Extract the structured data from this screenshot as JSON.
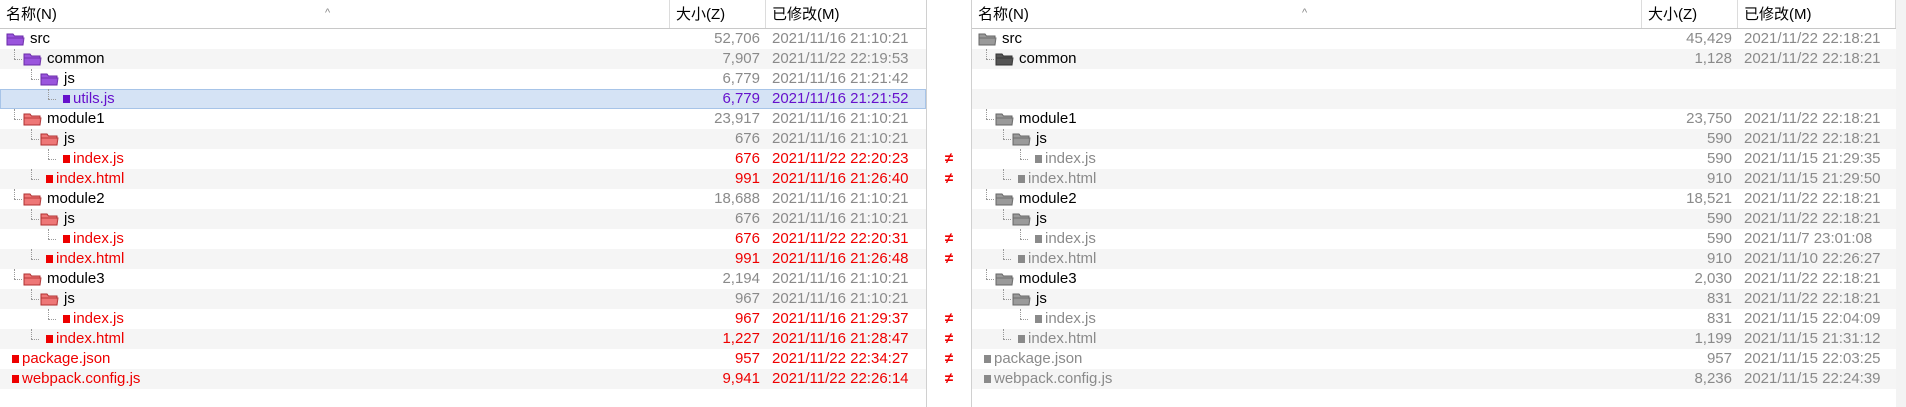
{
  "columns": {
    "name": "名称(N)",
    "size": "大小(Z)",
    "modified": "已修改(M)"
  },
  "diff_marker": "≠",
  "colors": {
    "modified": "#ee0000",
    "selected_text": "#6611cc",
    "unchanged": "#8a8a8a",
    "selection_bg": "#d5e3f5",
    "left_folder_modified": "#ee7777",
    "left_folder_selected": "#9a55dd",
    "right_folder": "#9a9a9a"
  },
  "left_pane": {
    "rows": [
      {
        "name": "src",
        "size": "52,706",
        "date": "2021/11/16 21:10:21",
        "type": "folder",
        "style": "gray",
        "depth": 0,
        "icon": "folder-purple-icon",
        "label_color": "black"
      },
      {
        "name": "common",
        "size": "7,907",
        "date": "2021/11/22 22:19:53",
        "type": "folder",
        "style": "gray",
        "depth": 1,
        "icon": "folder-purple-icon",
        "label_color": "black"
      },
      {
        "name": "js",
        "size": "6,779",
        "date": "2021/11/16 21:21:42",
        "type": "folder",
        "style": "gray",
        "depth": 2,
        "icon": "folder-purple-icon",
        "label_color": "black"
      },
      {
        "name": "utils.js",
        "size": "6,779",
        "date": "2021/11/16 21:21:52",
        "type": "file",
        "style": "purple",
        "depth": 3,
        "icon": "file-square-icon",
        "selected": true
      },
      {
        "name": "module1",
        "size": "23,917",
        "date": "2021/11/16 21:10:21",
        "type": "folder",
        "style": "gray",
        "depth": 1,
        "icon": "folder-red-icon",
        "label_color": "black"
      },
      {
        "name": "js",
        "size": "676",
        "date": "2021/11/16 21:10:21",
        "type": "folder",
        "style": "gray",
        "depth": 2,
        "icon": "folder-red-icon",
        "label_color": "black"
      },
      {
        "name": "index.js",
        "size": "676",
        "date": "2021/11/22 22:20:23",
        "type": "file",
        "style": "red",
        "depth": 3,
        "icon": "file-square-icon",
        "diff": true
      },
      {
        "name": "index.html",
        "size": "991",
        "date": "2021/11/16 21:26:40",
        "type": "file",
        "style": "red",
        "depth": 2,
        "icon": "file-square-icon",
        "diff": true
      },
      {
        "name": "module2",
        "size": "18,688",
        "date": "2021/11/16 21:10:21",
        "type": "folder",
        "style": "gray",
        "depth": 1,
        "icon": "folder-red-icon",
        "label_color": "black"
      },
      {
        "name": "js",
        "size": "676",
        "date": "2021/11/16 21:10:21",
        "type": "folder",
        "style": "gray",
        "depth": 2,
        "icon": "folder-red-icon",
        "label_color": "black"
      },
      {
        "name": "index.js",
        "size": "676",
        "date": "2021/11/22 22:20:31",
        "type": "file",
        "style": "red",
        "depth": 3,
        "icon": "file-square-icon",
        "diff": true
      },
      {
        "name": "index.html",
        "size": "991",
        "date": "2021/11/16 21:26:48",
        "type": "file",
        "style": "red",
        "depth": 2,
        "icon": "file-square-icon",
        "diff": true
      },
      {
        "name": "module3",
        "size": "2,194",
        "date": "2021/11/16 21:10:21",
        "type": "folder",
        "style": "gray",
        "depth": 1,
        "icon": "folder-red-icon",
        "label_color": "black"
      },
      {
        "name": "js",
        "size": "967",
        "date": "2021/11/16 21:10:21",
        "type": "folder",
        "style": "gray",
        "depth": 2,
        "icon": "folder-red-icon",
        "label_color": "black"
      },
      {
        "name": "index.js",
        "size": "967",
        "date": "2021/11/16 21:29:37",
        "type": "file",
        "style": "red",
        "depth": 3,
        "icon": "file-square-icon",
        "diff": true
      },
      {
        "name": "index.html",
        "size": "1,227",
        "date": "2021/11/16 21:28:47",
        "type": "file",
        "style": "red",
        "depth": 2,
        "icon": "file-square-icon",
        "diff": true
      },
      {
        "name": "package.json",
        "size": "957",
        "date": "2021/11/22 22:34:27",
        "type": "file",
        "style": "red",
        "depth": 0,
        "icon": "file-square-icon",
        "diff": true
      },
      {
        "name": "webpack.config.js",
        "size": "9,941",
        "date": "2021/11/22 22:26:14",
        "type": "file",
        "style": "red",
        "depth": 0,
        "icon": "file-square-icon",
        "diff": true
      }
    ]
  },
  "right_pane": {
    "rows": [
      {
        "name": "src",
        "size": "45,429",
        "date": "2021/11/22 22:18:21",
        "type": "folder",
        "style": "gray",
        "depth": 0,
        "icon": "folder-gray-icon",
        "label_color": "black"
      },
      {
        "name": "common",
        "size": "1,128",
        "date": "2021/11/22 22:18:21",
        "type": "folder",
        "style": "gray",
        "depth": 1,
        "icon": "folder-dark-icon",
        "label_color": "black"
      },
      {
        "name": "",
        "size": "",
        "date": "",
        "type": "blank",
        "depth": 0
      },
      {
        "name": "",
        "size": "",
        "date": "",
        "type": "blank",
        "depth": 0
      },
      {
        "name": "module1",
        "size": "23,750",
        "date": "2021/11/22 22:18:21",
        "type": "folder",
        "style": "gray",
        "depth": 1,
        "icon": "folder-gray-icon",
        "label_color": "black"
      },
      {
        "name": "js",
        "size": "590",
        "date": "2021/11/22 22:18:21",
        "type": "folder",
        "style": "gray",
        "depth": 2,
        "icon": "folder-gray-icon",
        "label_color": "black"
      },
      {
        "name": "index.js",
        "size": "590",
        "date": "2021/11/15 21:29:35",
        "type": "file",
        "style": "gray",
        "depth": 3,
        "icon": "file-square-icon"
      },
      {
        "name": "index.html",
        "size": "910",
        "date": "2021/11/15 21:29:50",
        "type": "file",
        "style": "gray",
        "depth": 2,
        "icon": "file-square-icon"
      },
      {
        "name": "module2",
        "size": "18,521",
        "date": "2021/11/22 22:18:21",
        "type": "folder",
        "style": "gray",
        "depth": 1,
        "icon": "folder-gray-icon",
        "label_color": "black"
      },
      {
        "name": "js",
        "size": "590",
        "date": "2021/11/22 22:18:21",
        "type": "folder",
        "style": "gray",
        "depth": 2,
        "icon": "folder-gray-icon",
        "label_color": "black"
      },
      {
        "name": "index.js",
        "size": "590",
        "date": "2021/11/7 23:01:08",
        "type": "file",
        "style": "gray",
        "depth": 3,
        "icon": "file-square-icon"
      },
      {
        "name": "index.html",
        "size": "910",
        "date": "2021/11/10 22:26:27",
        "type": "file",
        "style": "gray",
        "depth": 2,
        "icon": "file-square-icon"
      },
      {
        "name": "module3",
        "size": "2,030",
        "date": "2021/11/22 22:18:21",
        "type": "folder",
        "style": "gray",
        "depth": 1,
        "icon": "folder-gray-icon",
        "label_color": "black"
      },
      {
        "name": "js",
        "size": "831",
        "date": "2021/11/22 22:18:21",
        "type": "folder",
        "style": "gray",
        "depth": 2,
        "icon": "folder-gray-icon",
        "label_color": "black"
      },
      {
        "name": "index.js",
        "size": "831",
        "date": "2021/11/15 22:04:09",
        "type": "file",
        "style": "gray",
        "depth": 3,
        "icon": "file-square-icon"
      },
      {
        "name": "index.html",
        "size": "1,199",
        "date": "2021/11/15 21:31:12",
        "type": "file",
        "style": "gray",
        "depth": 2,
        "icon": "file-square-icon"
      },
      {
        "name": "package.json",
        "size": "957",
        "date": "2021/11/15 22:03:25",
        "type": "file",
        "style": "gray",
        "depth": 0,
        "icon": "file-square-icon"
      },
      {
        "name": "webpack.config.js",
        "size": "8,236",
        "date": "2021/11/15 22:24:39",
        "type": "file",
        "style": "gray",
        "depth": 0,
        "icon": "file-square-icon"
      }
    ]
  }
}
